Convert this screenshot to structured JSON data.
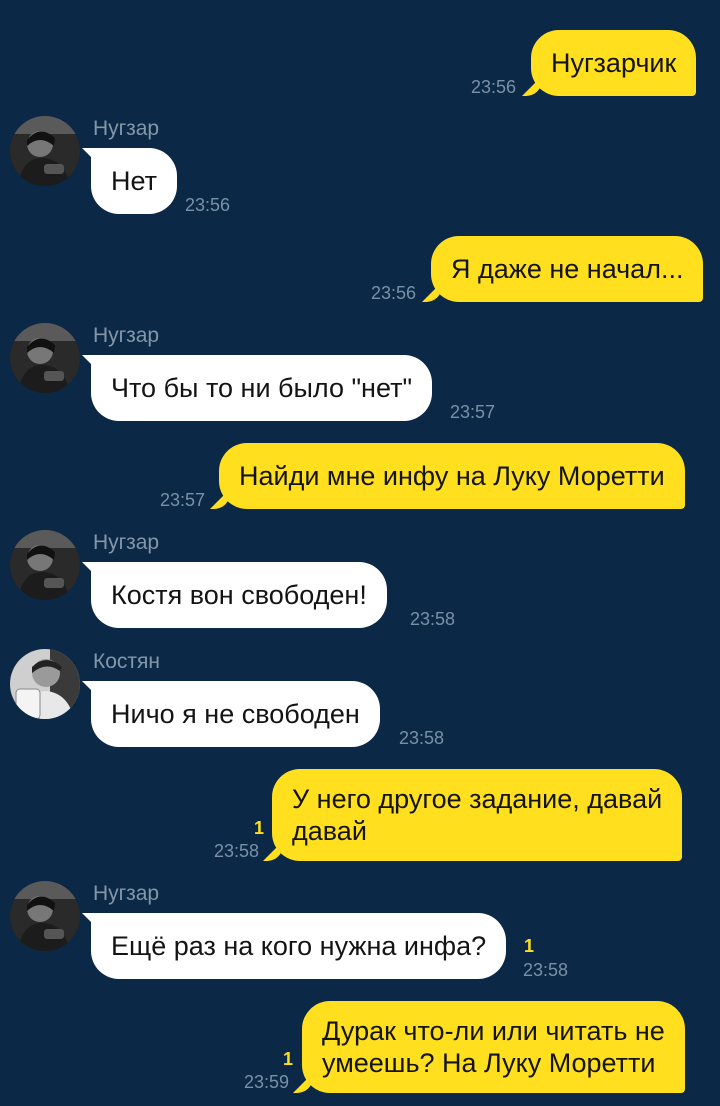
{
  "messages": [
    {
      "dir": "out",
      "text": "Нугзарчик",
      "time": "23:56"
    },
    {
      "dir": "in",
      "sender": "Нугзар",
      "text": "Нет",
      "time": "23:56"
    },
    {
      "dir": "out",
      "text": "Я даже не начал...",
      "time": "23:56"
    },
    {
      "dir": "in",
      "sender": "Нугзар",
      "text": "Что бы то ни было \"нет\"",
      "time": "23:57"
    },
    {
      "dir": "out",
      "text": "Найди  мне инфу на Луку Моретти",
      "time": "23:57"
    },
    {
      "dir": "in",
      "sender": "Нугзар",
      "text": "Костя вон свободен!",
      "time": "23:58"
    },
    {
      "dir": "in",
      "sender": "Костян",
      "text": "Ничо я не свободен",
      "time": "23:58"
    },
    {
      "dir": "out",
      "line1": "У него другое задание, давай",
      "line2": "давай",
      "time": "23:58",
      "unread": "1"
    },
    {
      "dir": "in",
      "sender": "Нугзар",
      "text": "Ещё раз на кого нужна инфа?",
      "time": "23:58",
      "unread": "1"
    },
    {
      "dir": "out",
      "line1": "Дурак что-ли или читать не",
      "line2": "умеешь? На Луку Моретти",
      "time": "23:59",
      "unread": "1"
    }
  ],
  "colors": {
    "background": "#0b2846",
    "outgoing_bubble": "#ffdf1e",
    "incoming_bubble": "#ffffff",
    "meta_text": "#7a90a6",
    "sender_name": "#8496a9"
  }
}
